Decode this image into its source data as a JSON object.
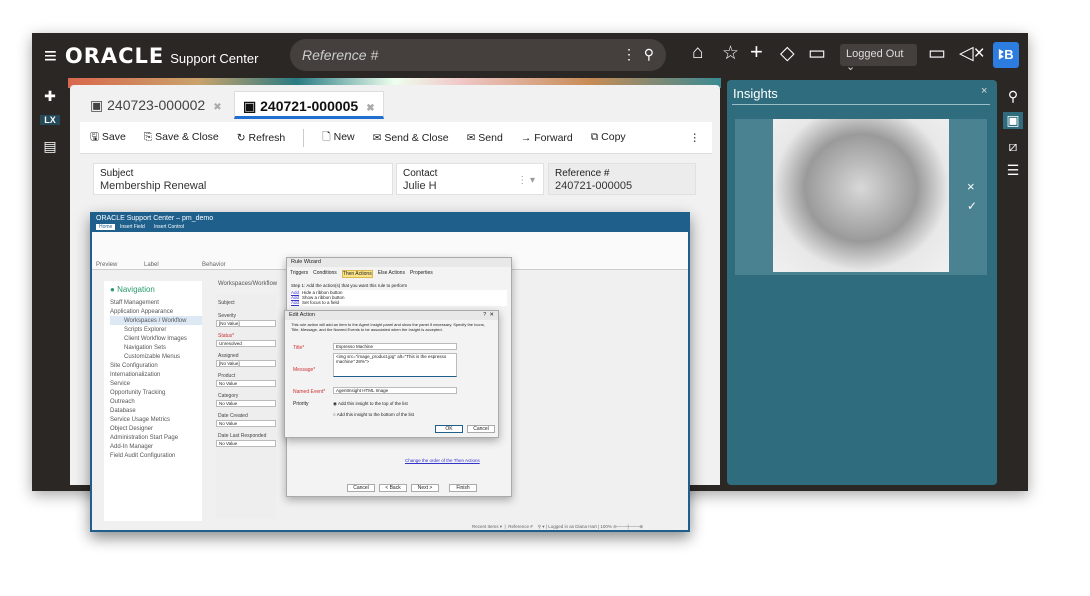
{
  "header": {
    "brand": "ORACLE",
    "product": "Support Center",
    "search_placeholder": "Reference #",
    "status": "Logged Out",
    "avatar": "ꔪB"
  },
  "tabs": [
    {
      "label": "240723-000002"
    },
    {
      "label": "240721-000005",
      "active": true
    }
  ],
  "toolbar": [
    "Save",
    "Save & Close",
    "Refresh",
    "New",
    "Send & Close",
    "Send",
    "Forward",
    "Copy"
  ],
  "fields": {
    "subject_label": "Subject",
    "subject_value": "Membership Renewal",
    "contact_label": "Contact",
    "contact_value": "Julie H",
    "ref_label": "Reference #",
    "ref_value": "240721-000005"
  },
  "left_rail": {
    "lx": "LX"
  },
  "insights": {
    "title": "Insights",
    "close": "×",
    "dismiss": "×",
    "accept": "✓"
  },
  "inset": {
    "title": "ORACLE Support Center – pm_demo",
    "ribbon_tabs": [
      "Home",
      "Insert Field",
      "Insert Control"
    ],
    "ribbon_groups": [
      "Preview",
      "Label",
      "Behavior"
    ],
    "nav_title": "Navigation",
    "nav_items": [
      "Staff Management",
      "Application Appearance",
      "Workspaces / Workflow",
      "Scripts Explorer",
      "Client Workflow Images",
      "Navigation Sets",
      "Customizable Menus",
      "Site Configuration",
      "Internationalization",
      "Service",
      "Opportunity Tracking",
      "Outreach",
      "Database",
      "Service Usage Metrics",
      "Object Designer",
      "Administration Start Page",
      "Add-In Manager",
      "Field Audit Configuration"
    ],
    "breadcrumb": "Workspaces/Workflow",
    "form_labels": [
      "Subject",
      "Severity",
      "Status*",
      "Assigned",
      "Product",
      "Category",
      "Date Created",
      "Date Last Responded"
    ],
    "form_values": [
      "[No Value]",
      "Unresolved",
      "[No Value]",
      "No Value",
      "No Value"
    ],
    "wizard": {
      "title": "Rule Wizard",
      "steps": [
        "Triggers",
        "Conditions",
        "Then Actions",
        "Else Actions",
        "Properties"
      ],
      "step_text": "Step 1: Add the action(s) that you want this rule to perform",
      "actions": [
        "Hide a ribbon button",
        "Show a ribbon button",
        "Set focus to a field"
      ],
      "add": "Add",
      "reorder": "Change the order of the Then Actions",
      "buttons": [
        "Cancel",
        "< Back",
        "Next >",
        "Finish"
      ]
    },
    "edit_action": {
      "title": "Edit Action",
      "info": "This rule action will add an item to the Agent Insight panel and show the panel if necessary. Specify the Icons, Title, Message, and the Named Events to be associated when the Insight is accepted.",
      "title_label": "Title*",
      "title_value": "Espresso Machine",
      "message_label": "Message*",
      "message_value": "<img src=\"image_product.jpg\" alt=\"This is the espresso machine\" 28%\">",
      "event_label": "Named Event*",
      "event_value": "AgentInsight HTML Image",
      "priority_label": "Priority",
      "priority_options": [
        "Add this insight to the top of the list",
        "Add this insight to the bottom of the list"
      ],
      "ok": "OK",
      "cancel": "Cancel"
    },
    "status": [
      "Recent Items",
      "Reference #",
      "Logged in as Diana Hart",
      "100%"
    ]
  }
}
